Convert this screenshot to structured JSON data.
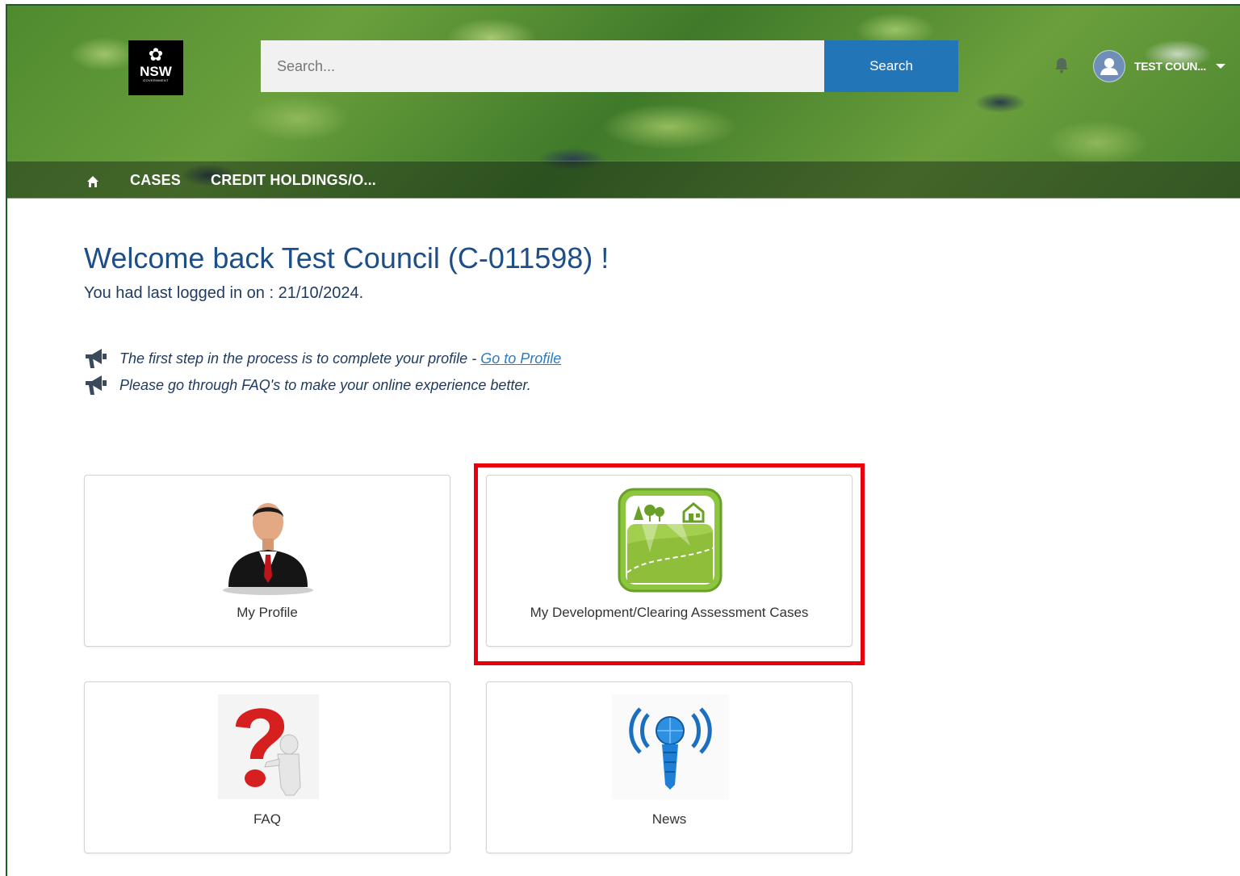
{
  "header": {
    "logo_text": "NSW",
    "logo_subtext": "GOVERNMENT",
    "search_placeholder": "Search...",
    "search_button": "Search",
    "user_name": "TEST COUN..."
  },
  "nav": {
    "items": [
      {
        "label": "CASES"
      },
      {
        "label": "CREDIT HOLDINGS/O..."
      }
    ]
  },
  "welcome": {
    "title": "Welcome back Test Council (C-011598) !",
    "last_login": "You had last logged in on : 21/10/2024."
  },
  "notices": [
    {
      "text": "The first step in the process is to complete your profile - ",
      "link": "Go to Profile"
    },
    {
      "text": "Please go through FAQ's to make your online experience better."
    }
  ],
  "tiles": [
    {
      "label": "My Profile",
      "icon": "business-person-icon"
    },
    {
      "label": "My Development/Clearing Assessment Cases",
      "icon": "landscape-development-icon"
    },
    {
      "label": "FAQ",
      "icon": "question-mark-person-icon"
    },
    {
      "label": "News",
      "icon": "broadcast-tower-icon"
    }
  ],
  "colors": {
    "accent": "#2276b8",
    "title": "#1c4f8a",
    "highlight": "#e8000d"
  }
}
